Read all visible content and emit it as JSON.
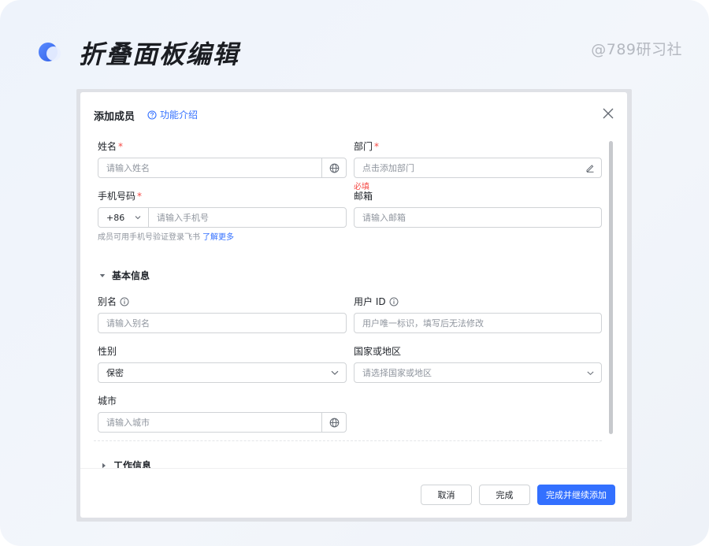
{
  "header": {
    "title": "折叠面板编辑",
    "watermark": "@789研习社"
  },
  "dialog": {
    "title": "添加成员",
    "help_label": "功能介绍",
    "fields": {
      "name": {
        "label": "姓名",
        "required": "*",
        "placeholder": "请输入姓名"
      },
      "department": {
        "label": "部门",
        "required": "*",
        "placeholder": "点击添加部门",
        "error": "必填"
      },
      "phone": {
        "label": "手机号码",
        "required": "*",
        "country_code": "+86",
        "placeholder": "请输入手机号",
        "hint": "成员可用手机号验证登录飞书",
        "hint_link": "了解更多"
      },
      "email": {
        "label": "邮箱",
        "placeholder": "请输入邮箱"
      },
      "alias": {
        "label": "别名",
        "placeholder": "请输入别名"
      },
      "user_id": {
        "label": "用户 ID",
        "placeholder": "用户唯一标识，填写后无法修改"
      },
      "gender": {
        "label": "性别",
        "value": "保密"
      },
      "country": {
        "label": "国家或地区",
        "placeholder": "请选择国家或地区"
      },
      "city": {
        "label": "城市",
        "placeholder": "请输入城市"
      }
    },
    "sections": {
      "basic": "基本信息",
      "work": "工作信息"
    },
    "buttons": {
      "cancel": "取消",
      "done": "完成",
      "done_continue": "完成并继续添加"
    }
  },
  "colors": {
    "accent": "#3370ff",
    "error": "#f54a45",
    "text": "#1f2329",
    "placeholder": "#8f959e"
  }
}
